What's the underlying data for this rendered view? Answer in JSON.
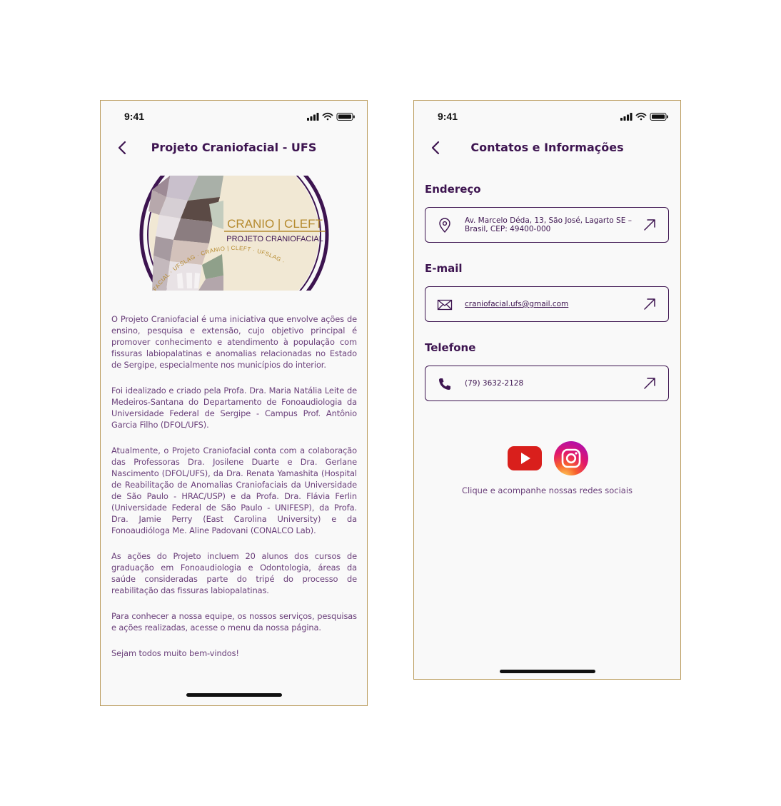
{
  "status_bar": {
    "time": "9:41"
  },
  "about_screen": {
    "title": "Projeto Craniofacial - UFS",
    "logo": {
      "main_text": "CRANIO | CLEFT",
      "sub_text": "PROJETO CRANIOFACIAL",
      "ring_text": "PROJETO CRANIOFACIAL · UFSLAG · CRANIO | CLEFT · UFSLAG ·"
    },
    "paragraphs": [
      "O Projeto Craniofacial é uma iniciativa que envolve ações de ensino, pesquisa e extensão, cujo objetivo principal é promover conhecimento e atendimento à população com fissuras labiopalatinas e anomalias relacionadas no Estado de Sergipe, especialmente nos municípios do interior.",
      "Foi idealizado e criado pela Profa. Dra. Maria Natália Leite de Medeiros-Santana do Departamento de Fonoaudiologia da Universidade Federal de Sergipe - Campus Prof. Antônio Garcia Filho (DFOL/UFS).",
      "Atualmente, o Projeto Craniofacial conta com a colaboração das Professoras Dra. Josilene Duarte e Dra. Gerlane Nascimento (DFOL/UFS), da Dra. Renata Yamashita (Hospital de Reabilitação de Anomalias Craniofaciais da Universidade de São Paulo - HRAC/USP) e da Profa. Dra. Flávia Ferlin (Universidade Federal de São Paulo - UNIFESP), da Profa. Dra. Jamie Perry (East Carolina University) e da Fonoaudióloga Me. Aline Padovani (CONALCO Lab).",
      "As ações do Projeto incluem 20 alunos dos cursos de graduação em Fonoaudiologia e Odontologia, áreas da saúde consideradas parte do tripé do processo de reabilitação das fissuras labiopalatinas.",
      "Para conhecer a nossa equipe, os nossos serviços, pesquisas e ações realizadas, acesse o menu da nossa página.",
      "Sejam todos muito bem-vindos!"
    ]
  },
  "contact_screen": {
    "title": "Contatos e Informações",
    "address": {
      "label": "Endereço",
      "value": "Av. Marcelo Déda, 13, São José, Lagarto SE – Brasil, CEP: 49400-000"
    },
    "email": {
      "label": "E-mail",
      "value": "craniofacial.ufs@gmail.com"
    },
    "phone": {
      "label": "Telefone",
      "value": "(79) 3632-2128"
    },
    "social_caption": "Clique e acompanhe nossas redes sociais"
  },
  "colors": {
    "brand_purple": "#3d1450",
    "text_purple": "#6a3f7a",
    "gold": "#b99a5a",
    "youtube_red": "#e52d27"
  },
  "icons": [
    "back-chevron-icon",
    "signal-icon",
    "wifi-icon",
    "battery-icon",
    "location-pin-icon",
    "envelope-icon",
    "phone-icon",
    "external-arrow-icon",
    "youtube-icon",
    "instagram-icon"
  ]
}
